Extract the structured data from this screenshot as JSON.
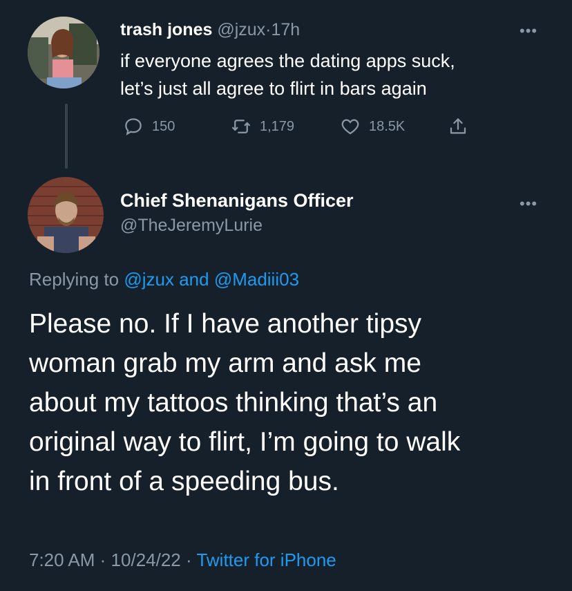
{
  "parent_tweet": {
    "display_name": "trash jones",
    "handle": "@jzux",
    "separator": "·",
    "time": "17h",
    "text_line1": "if everyone agrees the dating apps suck,",
    "text_line2": "let’s just all agree to flirt in bars again",
    "more_icon": "ellipsis-icon",
    "actions": {
      "replies": "150",
      "retweets": "1,179",
      "likes": "18.5K"
    }
  },
  "reply_tweet": {
    "display_name": "Chief Shenanigans Officer",
    "handle": "@TheJeremyLurie",
    "more_icon": "ellipsis-icon",
    "replying_prefix": "Replying to",
    "replying_user1": "@jzux",
    "replying_and": "and",
    "replying_user2": "@Madiii03",
    "text_lines": [
      "Please no. If I have another tipsy",
      "woman grab my arm and ask me",
      "about my tattoos thinking that’s an",
      "original way to flirt, I’m going to walk",
      "in front of a speeding bus."
    ],
    "time": "7:20 AM",
    "sep1": "·",
    "date": "10/24/22",
    "sep2": "·",
    "source": "Twitter for iPhone"
  },
  "colors": {
    "background": "#15202b",
    "text": "#ffffff",
    "muted": "#8b98a5",
    "link": "#1d9bf0",
    "thread_line": "#38444d"
  }
}
